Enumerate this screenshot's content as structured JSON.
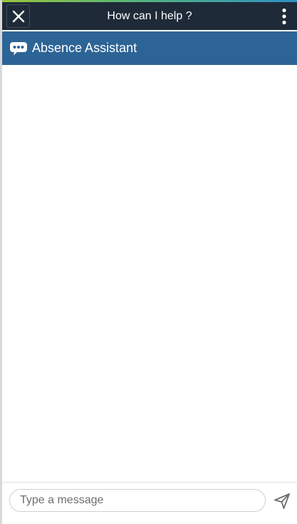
{
  "topbar": {
    "title": "How can I help ?",
    "close_icon": "close-icon",
    "menu_icon": "more-vertical-icon"
  },
  "assistant": {
    "name": "Absence Assistant",
    "icon": "chat-bubble-icon"
  },
  "composer": {
    "placeholder": "Type a message",
    "value": "",
    "send_icon": "send-icon"
  },
  "colors": {
    "topbar_bg": "#1e2a38",
    "header_bg": "#2d6496",
    "accent_strip": [
      "#9bc53d",
      "#2f8fc4"
    ]
  }
}
